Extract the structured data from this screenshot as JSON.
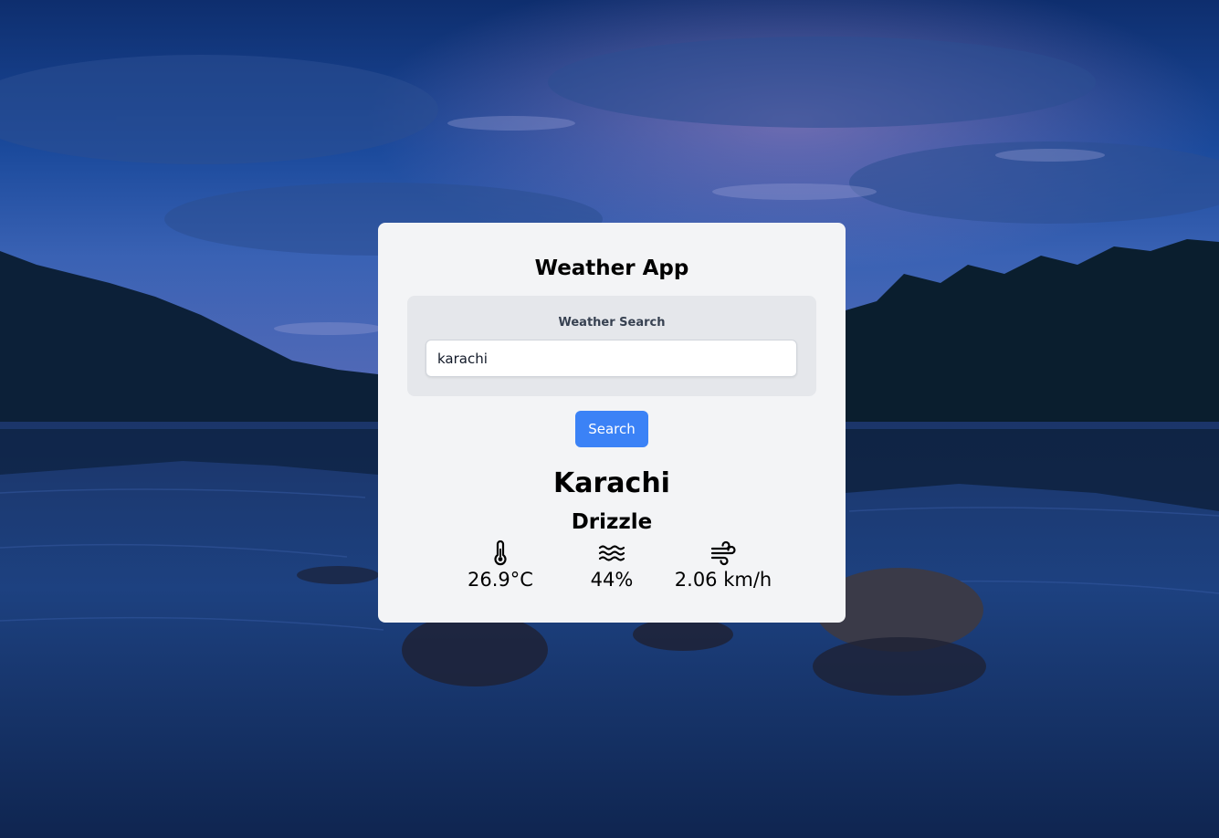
{
  "app": {
    "title": "Weather App"
  },
  "search": {
    "label": "Weather Search",
    "value": "karachi",
    "button_label": "Search"
  },
  "weather": {
    "city": "Karachi",
    "condition": "Drizzle",
    "temperature": "26.9°C",
    "humidity": "44%",
    "wind_speed": "2.06 km/h"
  },
  "icons": {
    "temperature": "thermometer-icon",
    "humidity": "water-waves-icon",
    "wind": "wind-icon"
  },
  "colors": {
    "card_background": "#f3f4f6",
    "panel_background": "#e5e7eb",
    "button": "#3b82f6",
    "button_text": "#ffffff"
  }
}
